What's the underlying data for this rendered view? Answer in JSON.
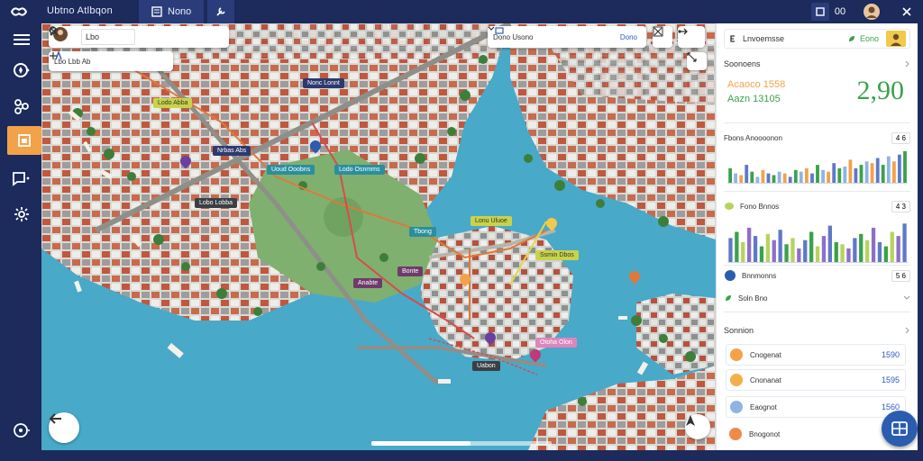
{
  "app": {
    "title": "Ubtno Atlbqon"
  },
  "tabs": [
    {
      "label": "Nono"
    }
  ],
  "window_controls": {
    "layout_label": "00"
  },
  "map": {
    "search_primary": {
      "value": "Lbo"
    },
    "search_secondary": {
      "value": "Lbo Lbb Ab"
    },
    "dropdown": {
      "value": "Dono Usono",
      "selected": "Dono"
    },
    "labels": [
      {
        "text": "Lodo Abba"
      },
      {
        "text": "Nonc Lonnt"
      },
      {
        "text": "Nrbas Abs"
      },
      {
        "text": "Uoud Ooobns"
      },
      {
        "text": "Lodo Osnmms"
      },
      {
        "text": "Lobo Lobba"
      },
      {
        "text": "Tbong"
      },
      {
        "text": "Lonu Uluoe"
      },
      {
        "text": "Bonte"
      },
      {
        "text": "Anabte"
      },
      {
        "text": "Ssmin Dbos"
      },
      {
        "text": "Otoha Olon"
      },
      {
        "text": "Uabon"
      }
    ],
    "scale_bar": {
      "fraction": 0.55
    }
  },
  "panel": {
    "header": {
      "title": "Lnvoemsse",
      "badge": "Eono"
    },
    "section1": {
      "title": "Soonoens"
    },
    "stat": {
      "line1": "Acaoco 1558",
      "line2": "Aazn 13105",
      "big_value": "2,90"
    },
    "chart1": {
      "title": "Fbons Anoooonon",
      "value": "4 6"
    },
    "chart2": {
      "title": "Fono Bnnos",
      "value": "4 3"
    },
    "row3": {
      "title": "Bnnmonns",
      "value": "5 6"
    },
    "row4": {
      "title": "Soln Bno"
    },
    "section2": {
      "title": "Sonnion"
    },
    "list": [
      {
        "name": "Cnogenat",
        "value": "1590",
        "color": "#f3a24a"
      },
      {
        "name": "Cnonanat",
        "value": "1595",
        "color": "#f3b04a"
      },
      {
        "name": "Eaognot",
        "value": "1560",
        "color": "#8fb4e4"
      },
      {
        "name": "Bnogonot",
        "value": "",
        "color": "#ee8a4a"
      }
    ]
  },
  "colors": {
    "nav_bg": "#1c2a5c",
    "accent_orange": "#f3a24a",
    "water": "#48a9c9",
    "land": "#7fb070",
    "accent_green": "#3aa24a",
    "accent_blue": "#2a5db0"
  },
  "chart_data": [
    {
      "type": "bar",
      "title": "Fbons Anoooonon",
      "series": [
        {
          "values": [
            0.45,
            0.3,
            0.25,
            0.55,
            0.35,
            0.2,
            0.4,
            0.3,
            0.25,
            0.35,
            0.3,
            0.2,
            0.4,
            0.35,
            0.45,
            0.3,
            0.55,
            0.4,
            0.35,
            0.6,
            0.45,
            0.5,
            0.7,
            0.45,
            0.55,
            0.65,
            0.6,
            0.75,
            0.55,
            0.8,
            0.65,
            0.85,
            0.95
          ]
        }
      ],
      "colors": [
        "#3aa24a",
        "#8fb4e4",
        "#f3a24a",
        "#5f79c9"
      ]
    },
    {
      "type": "bar",
      "title": "Fono Bnnos",
      "series": [
        {
          "values": [
            0.6,
            0.75,
            0.5,
            0.85,
            0.65,
            0.4,
            0.7,
            0.55,
            0.8,
            0.45,
            0.6,
            0.35,
            0.55,
            0.75,
            0.4,
            0.65,
            0.9,
            0.5,
            0.45,
            0.35,
            0.6,
            0.7,
            0.55,
            0.85,
            0.5,
            0.4,
            0.75,
            0.65,
            0.95
          ]
        }
      ],
      "colors": [
        "#5f79c9",
        "#3aa24a",
        "#b7d35f",
        "#8f6fc9"
      ]
    }
  ]
}
